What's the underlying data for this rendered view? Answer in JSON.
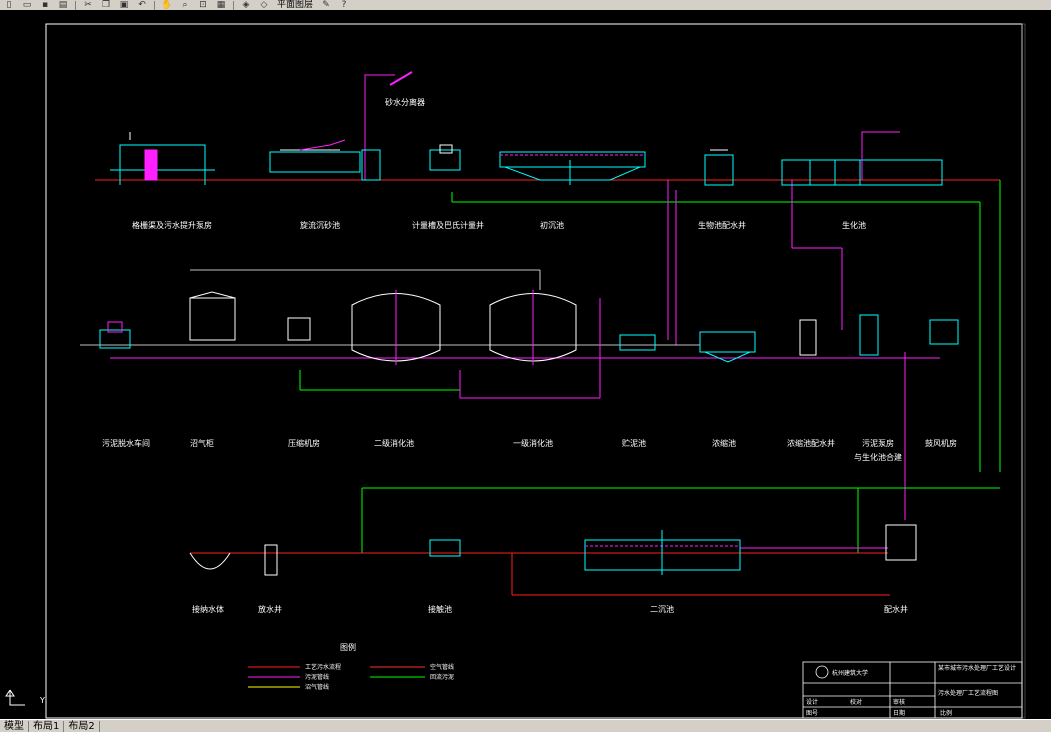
{
  "toolbar": {
    "layer_name": "平面图层",
    "icons": [
      "new-icon",
      "open-icon",
      "save-icon",
      "print-icon",
      "cut-icon",
      "copy-icon",
      "paste-icon",
      "undo-icon",
      "pan-icon",
      "zoom-icon",
      "zoom-window-icon",
      "properties-icon",
      "layers-icon",
      "layer-state-icon",
      "match-icon",
      "help-icon"
    ]
  },
  "drawing": {
    "row1_labels": [
      "格栅渠及污水提升泵房",
      "旋流沉砂池",
      "计量槽及巴氏计量井",
      "初沉池",
      "生物池配水井",
      "生化池"
    ],
    "row1_misc": [
      "砂水分离器"
    ],
    "row2_labels": [
      "污泥脱水车间",
      "沼气柜",
      "压缩机房",
      "二级消化池",
      "一级消化池",
      "贮泥池",
      "浓缩池",
      "浓缩池配水井",
      "污泥泵房",
      "鼓风机房"
    ],
    "row2_sub": "与生化池合建",
    "row3_labels": [
      "接纳水体",
      "放水井",
      "接触池",
      "二沉池",
      "配水井"
    ],
    "legend": {
      "title": "图例",
      "items": [
        "工艺污水流程",
        "污泥管线",
        "沼气管线",
        "空气管线",
        "回流污泥"
      ],
      "colors": {
        "sewage": "#ff2020",
        "sludge": "#ff20ff",
        "gas": "#ffff00",
        "air": "#00ff00",
        "return": "#ff3030"
      }
    },
    "titleblock": {
      "school": "杭州建筑大学",
      "project": "某市城市污水处理厂工艺设计",
      "sheet": "污水处理厂工艺流程图",
      "cells": [
        "设计",
        "校对",
        "审核",
        "图号",
        "日期",
        "比例"
      ]
    },
    "ucs": "Y"
  },
  "layout_tabs": [
    "模型",
    "布局1",
    "布局2"
  ]
}
